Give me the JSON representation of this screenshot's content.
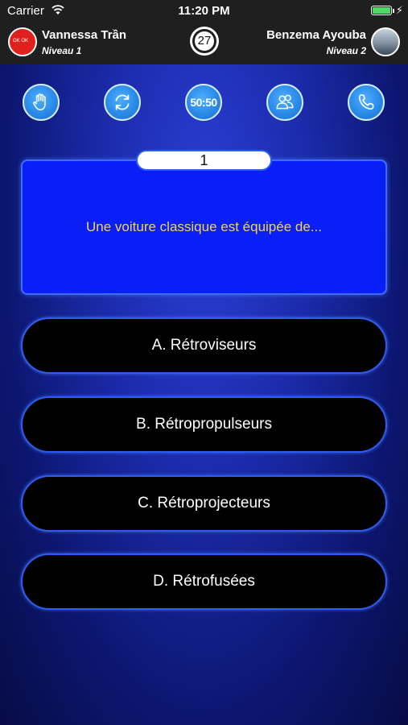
{
  "status_bar": {
    "carrier": "Carrier",
    "time": "11:20 PM",
    "battery_level": 1.0
  },
  "players": {
    "left": {
      "name": "Vannessa Trần",
      "level": "Niveau 1",
      "avatar_text": "OK OK"
    },
    "right": {
      "name": "Benzema Ayouba",
      "level": "Niveau 2"
    }
  },
  "timer": {
    "value": "27"
  },
  "jokers": [
    {
      "name": "hand-icon"
    },
    {
      "name": "swap-icon"
    },
    {
      "name": "fifty-fifty",
      "label": "50:50"
    },
    {
      "name": "audience-icon"
    },
    {
      "name": "phone-icon"
    }
  ],
  "question": {
    "number": "1",
    "text": "Une voiture classique est équipée de..."
  },
  "answers": [
    "A. Rétroviseurs",
    "B. Rétropropulseurs",
    "C. Rétroprojecteurs",
    "D. Rétrofusées"
  ],
  "colors": {
    "question_text": "#f5d24a",
    "question_box": "#0a1ff8",
    "answer_border": "#2d5cf0",
    "joker": "#2a8ae8"
  }
}
